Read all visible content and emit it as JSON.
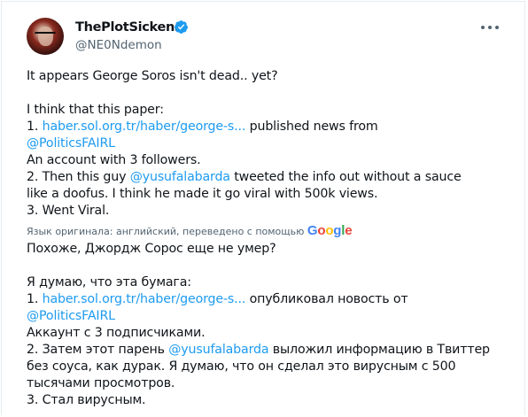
{
  "tweet": {
    "author_name": "ThePlotSickens",
    "author_handle": "@NE0Ndemon",
    "more_icon": "more-horizontal-icon",
    "verified_icon": "verified-badge-icon",
    "original": {
      "line1": "It appears George Soros isn't dead.. yet?",
      "line2": "I think that this paper:",
      "line3_prefix": "1. ",
      "line3_link": "haber.sol.org.tr/haber/george-s...",
      "line3_suffix": " published news from",
      "line4_mention": "@PoliticsFAIRL",
      "line5": "An account with 3 followers.",
      "line6_prefix": "2. Then this guy ",
      "line6_mention": "@yusufalabarda",
      "line6_suffix": " tweeted the info out without a sauce",
      "line7": "like a doofus. I think he made it go viral with 500k views.",
      "line8": "3. Went Viral."
    },
    "translation_notice": "Язык оригинала: английский, переведено с помощью",
    "translation_brand": "Google",
    "translated": {
      "line1": "Похоже, Джордж Сорос еще не умер?",
      "line2": "Я думаю, что эта бумага:",
      "line3_prefix": "1. ",
      "line3_link": "haber.sol.org.tr/haber/george-s...",
      "line3_suffix": " опубликовал новость от",
      "line4_mention": "@PoliticsFAIRL",
      "line5": "Аккаунт с 3 подписчиками.",
      "line6_prefix": "2. Затем этот парень ",
      "line6_mention": "@yusufalabarda",
      "line6_suffix": " выложил информацию в Твиттер",
      "line7": "без соуса, как дурак. Я думаю, что он сделал это вирусным с 500",
      "line8": "тысячами просмотров.",
      "line9": "3. Стал вирусным."
    }
  },
  "colors": {
    "link": "#1d9bf0",
    "text": "#0f1419",
    "secondary": "#536471",
    "verified": "#1d9bf0"
  }
}
